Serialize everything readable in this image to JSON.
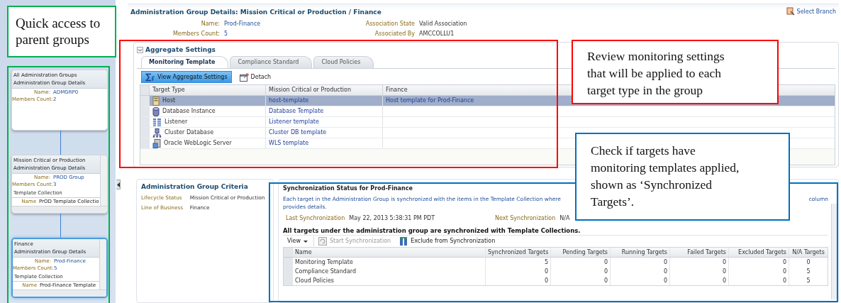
{
  "sidebar": {
    "cards": [
      {
        "title": "All Administration Groups",
        "subtitle": "Administration Group Details",
        "name_label": "Name:",
        "name": "ADMGRP0",
        "members_label": "Members Count:",
        "members": "2",
        "selected": false
      },
      {
        "title": "Mission Critical or Production",
        "subtitle": "Administration Group Details",
        "name_label": "Name:",
        "name": "PROD Group",
        "members_label": "Members Count:",
        "members": "3",
        "collection_heading": "Template Collection",
        "collection_label": "Name",
        "collection_value": "PrOD Template Collectio",
        "selected": false
      },
      {
        "title": "Finance",
        "subtitle": "Administration Group Details",
        "name_label": "Name:",
        "name": "Prod-Finance",
        "members_label": "Members Count:",
        "members": "5",
        "collection_heading": "Template Collection",
        "collection_label": "Name",
        "collection_value": "Prod-Finance Template",
        "selected": true
      }
    ]
  },
  "header": {
    "title": "Administration Group Details: Mission Critical or Production / Finance",
    "select_branch": "Select Branch",
    "left_fields": [
      {
        "label": "Name:",
        "value": "Prod-Finance"
      },
      {
        "label": "Members Count:",
        "value": "5"
      }
    ],
    "right_fields": [
      {
        "label": "Association State",
        "value": "Valid Association"
      },
      {
        "label": "Associated By",
        "value": "AMCCOLLU1"
      }
    ]
  },
  "aggregate": {
    "title": "Aggregate Settings",
    "expanded": true,
    "tabs": [
      {
        "label": "Monitoring Template",
        "selected": true
      },
      {
        "label": "Compliance Standard",
        "selected": false
      },
      {
        "label": "Cloud Policies",
        "selected": false
      }
    ],
    "toolbar": [
      {
        "label": "View Aggregate Settings",
        "kind": "primary"
      },
      {
        "label": "Detach",
        "kind": "detach"
      }
    ],
    "columns": [
      "Target Type",
      "Mission Critical or Production",
      "Finance"
    ],
    "rows": [
      {
        "kind": "host",
        "type": "Host",
        "template": "host-template",
        "finance": "Host template for Prod-Finance",
        "selected": true
      },
      {
        "kind": "database",
        "type": "Database Instance",
        "template": "Database Template",
        "selected": false
      },
      {
        "kind": "listener",
        "type": "Listener",
        "template": "Listener template",
        "selected": false
      },
      {
        "kind": "cluster",
        "type": "Cluster Database",
        "template": "Cluster DB template",
        "selected": false
      },
      {
        "kind": "weblogic",
        "type": "Oracle WebLogic Server",
        "template": "WLS template",
        "selected": false
      }
    ]
  },
  "criteria": {
    "title": "Administration Group Criteria",
    "fields": [
      {
        "label": "Lifecycle Status",
        "value": "Mission Critical or Production"
      },
      {
        "label": "Line of Business",
        "value": "Finance"
      }
    ]
  },
  "sync": {
    "title": "Synchronization Status for Prod-Finance",
    "description": [
      "Each target in the Administration Group is synchronized with the items in the Template Collection where",
      "column",
      "provides details."
    ],
    "last_label": "Last Synchronization",
    "last_value": "May 22, 2013 5:38:31 PM PDT",
    "next_label": "Next Synchronization",
    "next_value": "N/A",
    "message": "All targets under the administration group are synchronized with Template Collections.",
    "toolbar": [
      {
        "label": "View",
        "kind": "menu",
        "disabled": false
      },
      {
        "label": "Start Synchronization",
        "kind": "start",
        "disabled": true
      },
      {
        "label": "Exclude from Synchronization",
        "kind": "exclude",
        "disabled": false
      }
    ],
    "columns": [
      "Name",
      "Synchronized Targets",
      "Pending Targets",
      "Running Targets",
      "Failed Targets",
      "Excluded Targets",
      "N/A Targets"
    ],
    "rows": [
      [
        "Monitoring Template",
        "5",
        "0",
        "0",
        "0",
        "0",
        "0"
      ],
      [
        "Compliance Standard",
        "0",
        "0",
        "0",
        "0",
        "0",
        "5"
      ],
      [
        "Cloud Policies",
        "0",
        "0",
        "0",
        "0",
        "0",
        "5"
      ]
    ]
  },
  "callouts": [
    {
      "kind": "sidebar",
      "text": "Quick access to parent groups",
      "color": "#00b050"
    },
    {
      "kind": "aggregate",
      "text": "Review monitoring settings that will be applied to each target type in the group",
      "color": "#ff0000"
    },
    {
      "kind": "sync",
      "text": "Check if targets have monitoring templates applied, shown as ‘Synchronized Targets’.",
      "color": "#0070c0"
    }
  ]
}
